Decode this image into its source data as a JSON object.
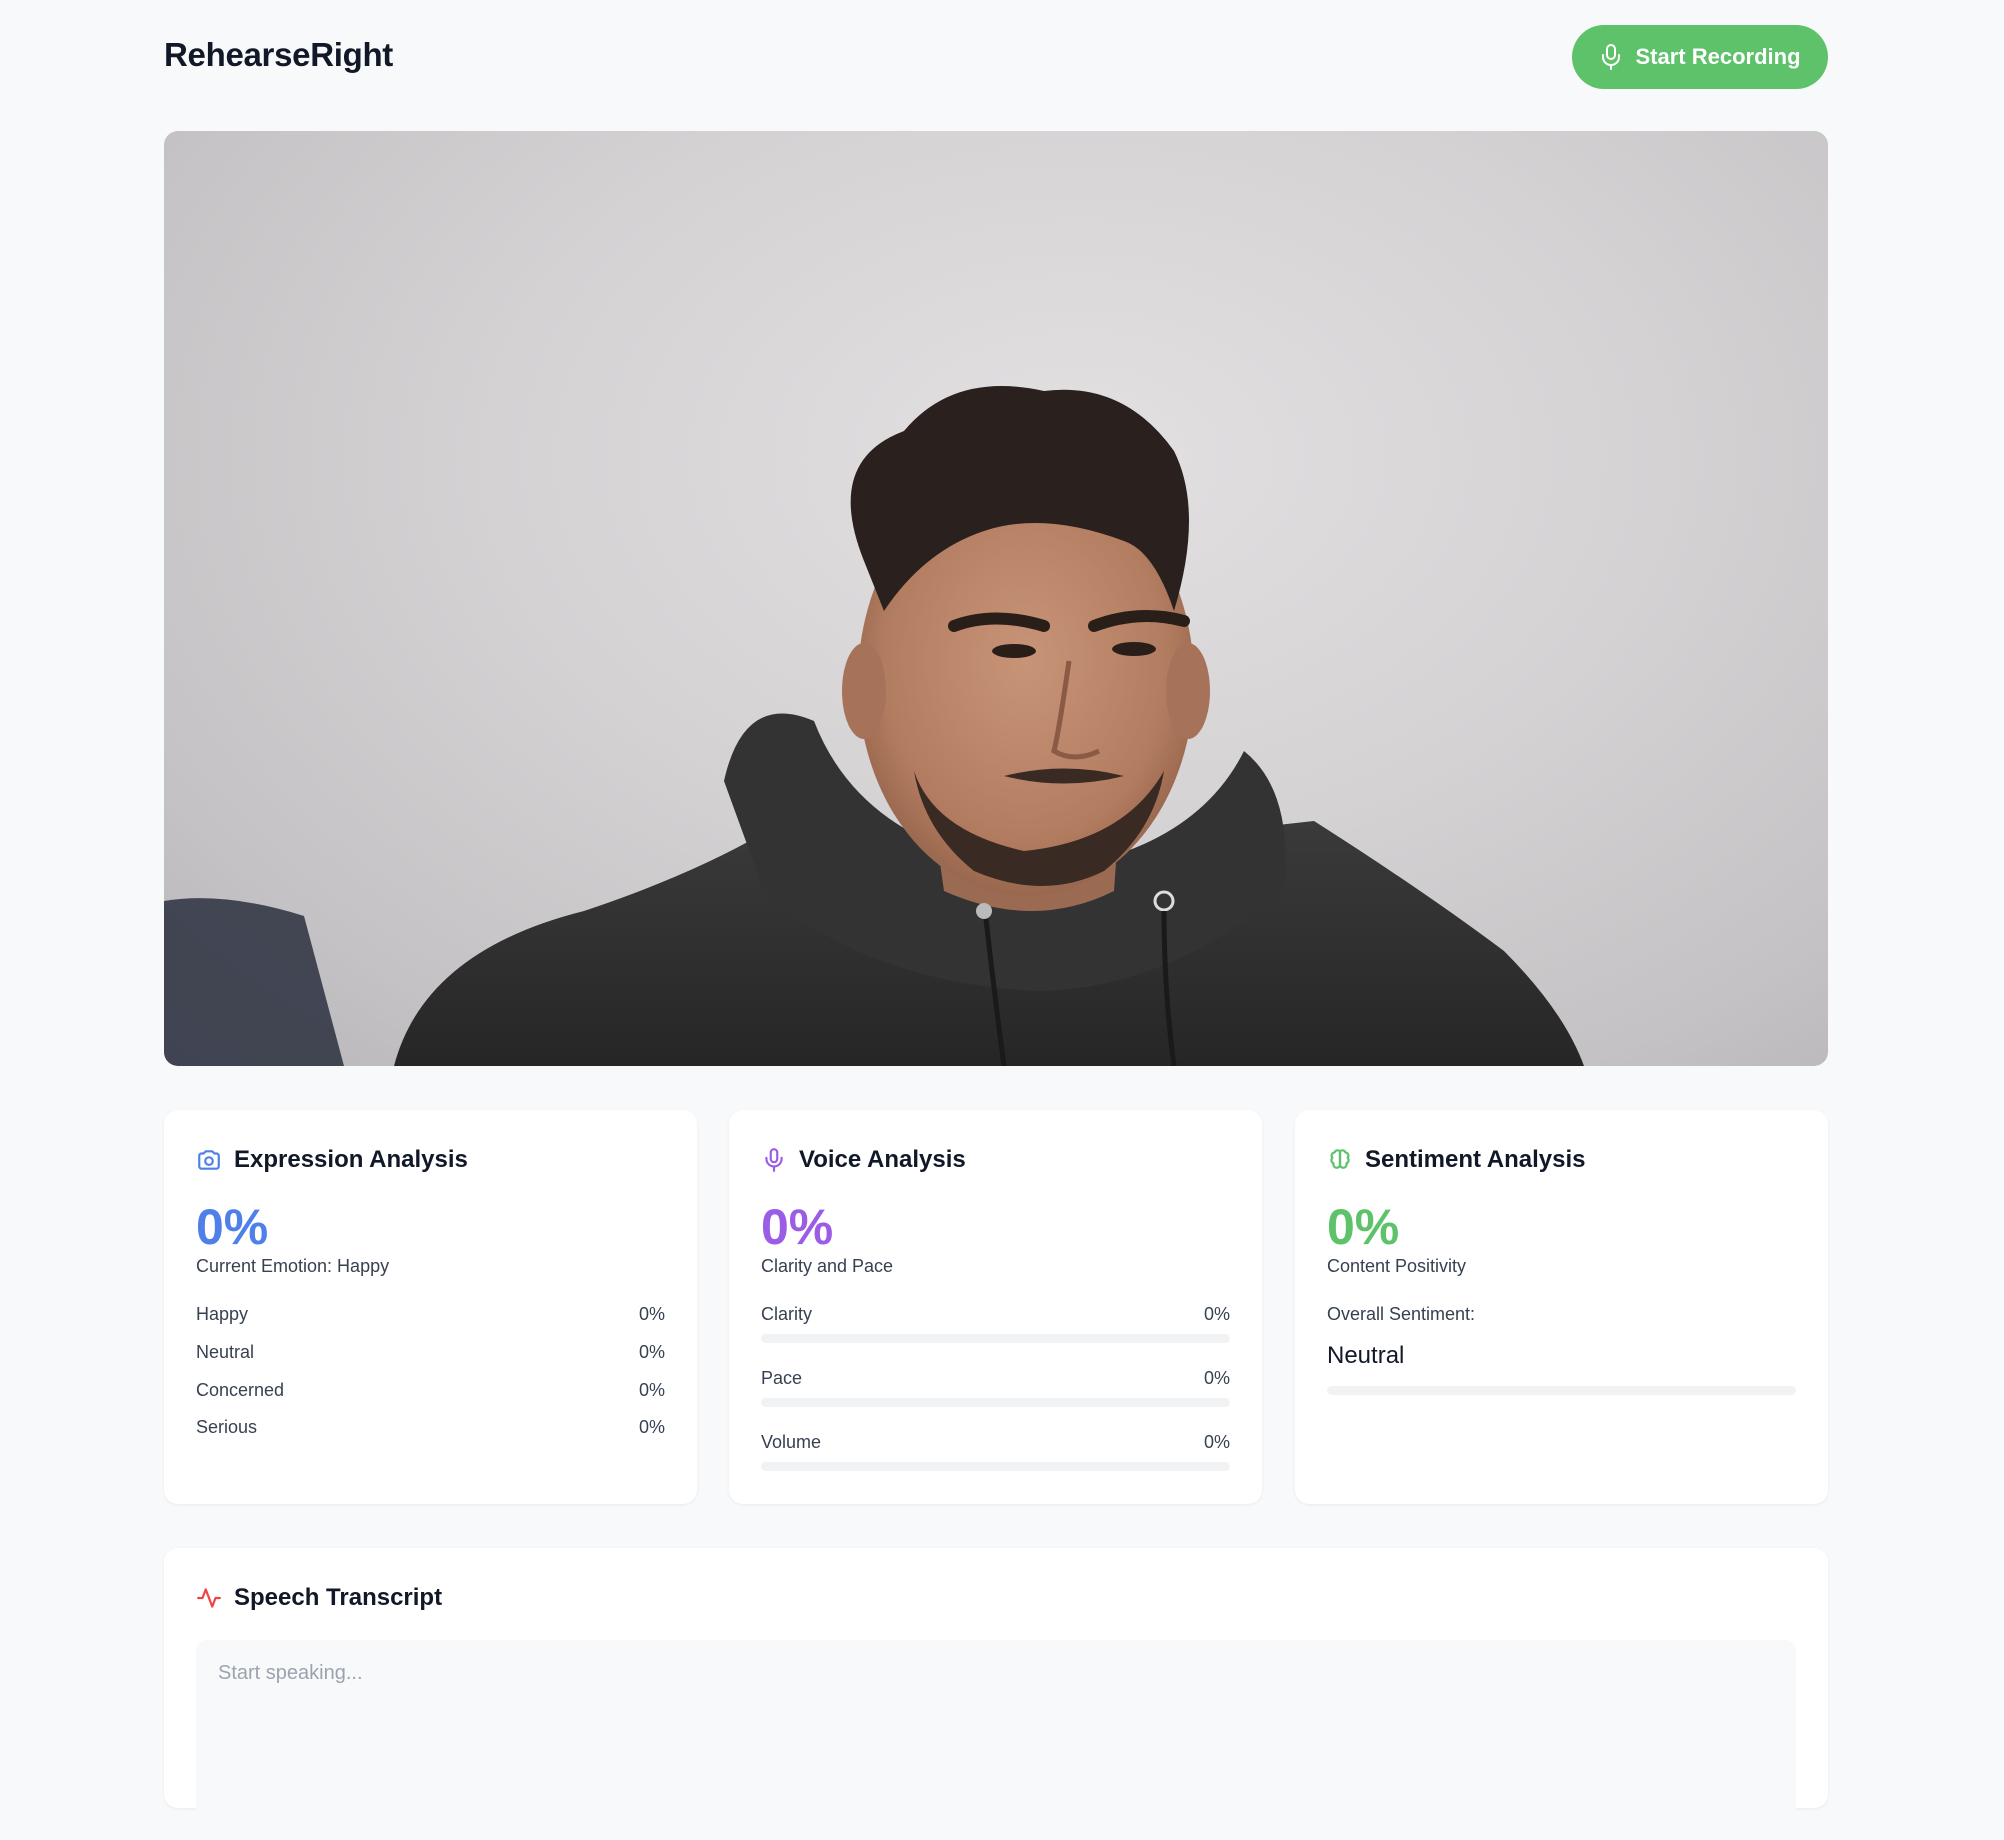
{
  "app": {
    "title": "RehearseRight"
  },
  "header": {
    "record_button": "Start Recording"
  },
  "colors": {
    "accent_green": "#5dc26a",
    "blue": "#4f7fe8",
    "purple": "#9b5de5",
    "green": "#5dc26a",
    "red": "#ef4444"
  },
  "expression": {
    "title": "Expression Analysis",
    "score": "0%",
    "caption": "Current Emotion: Happy",
    "items": [
      {
        "label": "Happy",
        "value": "0%"
      },
      {
        "label": "Neutral",
        "value": "0%"
      },
      {
        "label": "Concerned",
        "value": "0%"
      },
      {
        "label": "Serious",
        "value": "0%"
      }
    ]
  },
  "voice": {
    "title": "Voice Analysis",
    "score": "0%",
    "caption": "Clarity and Pace",
    "metrics": [
      {
        "label": "Clarity",
        "value": "0%",
        "level": 0
      },
      {
        "label": "Pace",
        "value": "0%",
        "level": 0
      },
      {
        "label": "Volume",
        "value": "0%",
        "level": 0
      }
    ]
  },
  "sentiment": {
    "title": "Sentiment Analysis",
    "score": "0%",
    "caption": "Content Positivity",
    "overall_label": "Overall Sentiment:",
    "overall_value": "Neutral",
    "level": 0
  },
  "transcript": {
    "title": "Speech Transcript",
    "placeholder": "Start speaking..."
  }
}
